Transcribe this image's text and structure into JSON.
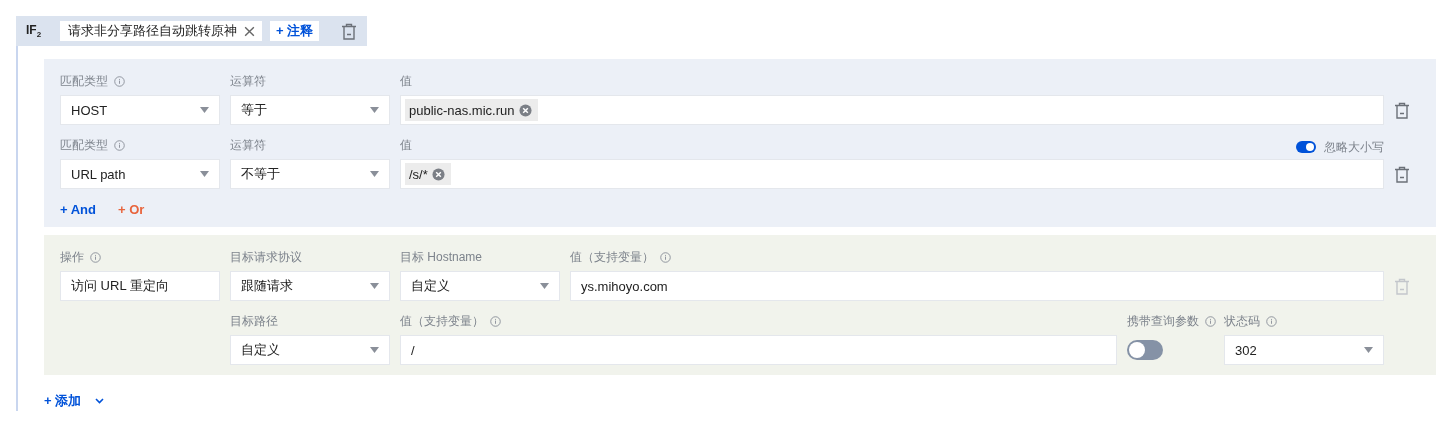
{
  "rule": {
    "title": "IF$_{2}$",
    "comment_tag": "请求非分享路径自动跳转原神",
    "add_comment": "+ 注释"
  },
  "conditions": [
    {
      "match_type_label": "匹配类型",
      "match_type": "HOST",
      "operator_label": "运算符",
      "operator": "等于",
      "value_label": "值",
      "tags": [
        "public-nas.mic.run"
      ]
    },
    {
      "match_type_label": "匹配类型",
      "match_type": "URL path",
      "operator_label": "运算符",
      "operator": "不等于",
      "value_label": "值",
      "tags": [
        "/s/*"
      ],
      "ignore_case": {
        "label": "忽略大小写",
        "on": true
      }
    }
  ],
  "logic_buttons": [
    {
      "label": "+ And",
      "color": "#0052d9"
    },
    {
      "label": "+ Or",
      "color": "#e8643c"
    }
  ],
  "action": {
    "operation": {
      "label": "操作",
      "info": true,
      "value": "访问 URL 重定向"
    },
    "delete_disabled": true,
    "rows": [
      {
        "fields": [
          {
            "kind": "select",
            "label": "目标请求协议",
            "info": false,
            "value": "跟随请求"
          },
          {
            "kind": "select",
            "label": "目标 Hostname",
            "info": false,
            "value": "自定义"
          },
          {
            "kind": "input",
            "label": "值（支持变量）",
            "info": true,
            "value": "ys.mihoyo.com"
          }
        ]
      },
      {
        "fields": [
          {
            "kind": "select",
            "label": "目标路径",
            "info": false,
            "value": "自定义"
          },
          {
            "kind": "input",
            "label": "值（支持变量）",
            "info": true,
            "value": "/"
          },
          {
            "kind": "toggle",
            "label": "携带查询参数",
            "info": true,
            "on": false
          },
          {
            "kind": "select",
            "label": "状态码",
            "info": true,
            "value": "302"
          }
        ]
      }
    ]
  },
  "add": {
    "label": "+ 添加"
  }
}
